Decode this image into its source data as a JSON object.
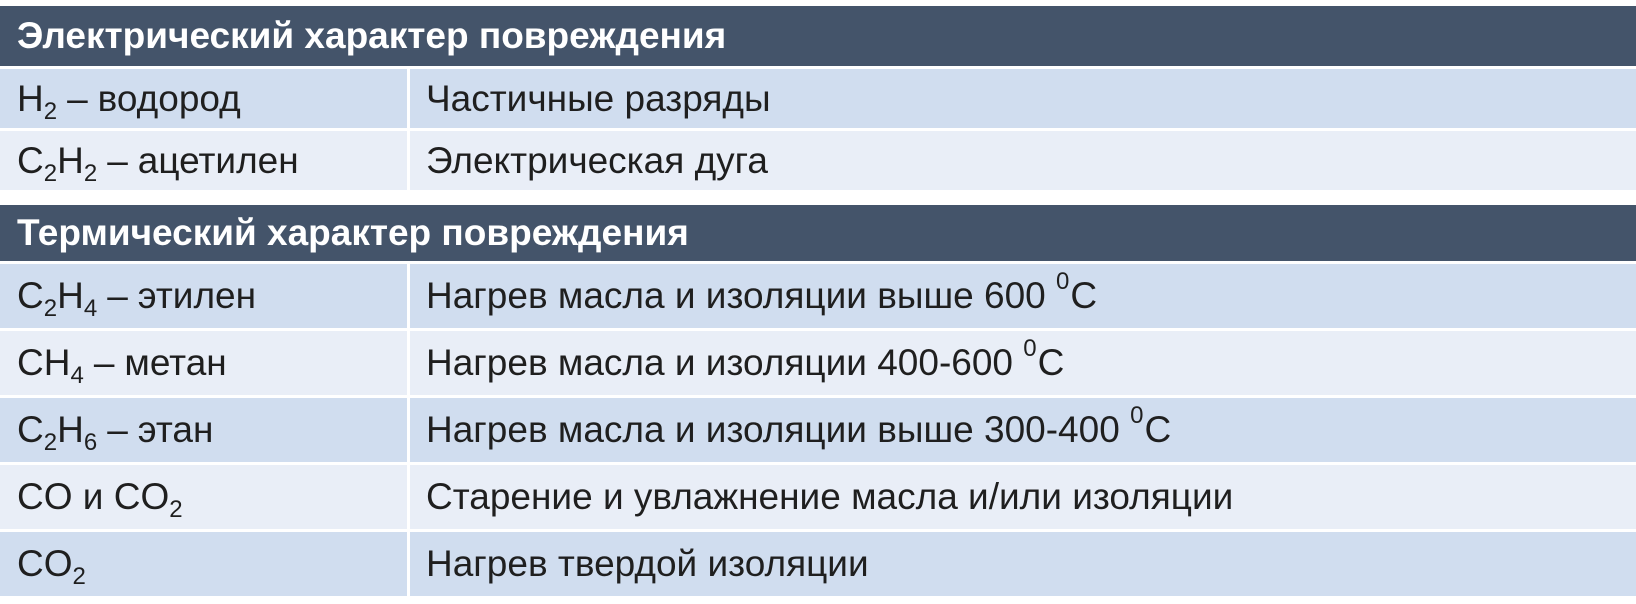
{
  "electrical": {
    "title": "Электрический характер повреждения",
    "rows": [
      {
        "gas": {
          "e1": "H",
          "s1": "2",
          "e2": "",
          "s2": "",
          "name": "водород"
        },
        "description": "Частичные разряды"
      },
      {
        "gas": {
          "e1": "C",
          "s1": "2",
          "e2": "H",
          "s2": "2",
          "name": "ацетилен"
        },
        "description": "Электрическая дуга"
      }
    ]
  },
  "thermal": {
    "title": "Термический характер повреждения",
    "rows": [
      {
        "gas": {
          "e1": "C",
          "s1": "2",
          "e2": "H",
          "s2": "4",
          "name": "этилен"
        },
        "description": {
          "text": "Нагрев масла и изоляции выше 600 ",
          "degree": "0",
          "unit": "C"
        }
      },
      {
        "gas": {
          "e1": "CH",
          "s1": "4",
          "name": "метан"
        },
        "description": {
          "text": "Нагрев масла и изоляции 400-600 ",
          "degree": "0",
          "unit": "C"
        }
      },
      {
        "gas": {
          "e1": "C",
          "s1": "2",
          "e2": "H",
          "s2": "6",
          "name": "этан"
        },
        "description": {
          "text": "Нагрев масла и изоляции выше 300-400 ",
          "degree": "0",
          "unit": "C"
        }
      },
      {
        "gas": {
          "text": "CO и CO",
          "s1": "2"
        },
        "description": "Старение и увлажнение масла и/или изоляции"
      },
      {
        "gas": {
          "text": "CO",
          "s1": "2"
        },
        "description": "Нагрев твердой изоляции"
      }
    ]
  },
  "separator": "–",
  "colors": {
    "header_bg": "#44546a",
    "row_dark": "#d0ddef",
    "row_light": "#e9eef7",
    "header_text": "#ffffff"
  }
}
